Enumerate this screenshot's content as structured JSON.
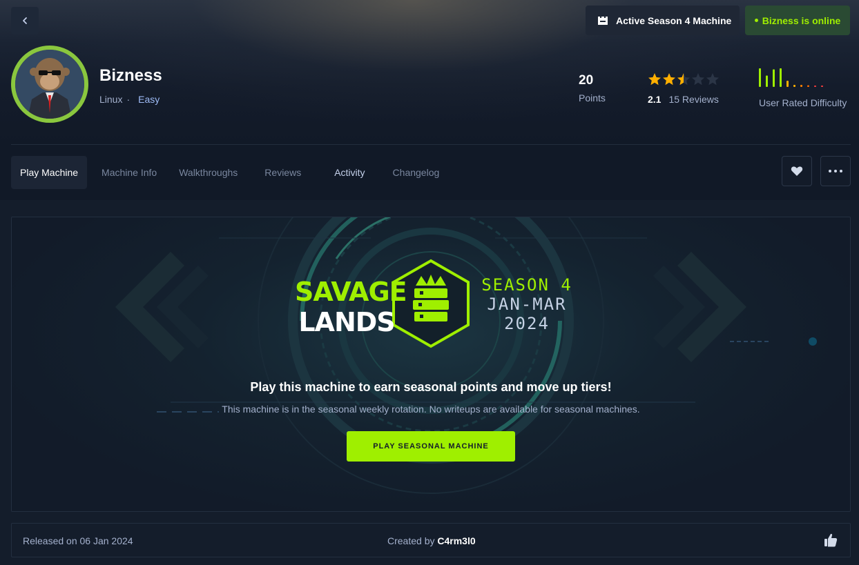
{
  "header": {
    "back_icon": "chevron-left-icon",
    "season_badge": {
      "icon": "castle-icon",
      "label": "Active Season 4 Machine"
    },
    "status_badge": {
      "label": "Bizness is online",
      "color": "#9fef00"
    }
  },
  "machine": {
    "name": "Bizness",
    "os": "Linux",
    "separator": "·",
    "difficulty": "Easy",
    "avatar_icon": "monkey-avatar-icon",
    "points": {
      "value": "20",
      "label": "Points"
    },
    "rating": {
      "value": "2.1",
      "reviews": "15 Reviews",
      "stars": 2.5,
      "max_stars": 5,
      "star_color": "#ffaf00"
    },
    "user_difficulty": {
      "label": "User Rated Difficulty",
      "levels": [
        0.9,
        0.55,
        0.85,
        0.9,
        0.3,
        0.1,
        0.1,
        0.08,
        0.06,
        0.06
      ],
      "colors": [
        "#9fef00",
        "#9fef00",
        "#9fef00",
        "#9fef00",
        "#ffaf00",
        "#ffaf00",
        "#ff8000",
        "#ff6b00",
        "#ff3e3e",
        "#ff3e3e"
      ]
    }
  },
  "tabs": [
    {
      "label": "Play Machine",
      "active": true
    },
    {
      "label": "Machine Info"
    },
    {
      "label": "Walkthroughs"
    },
    {
      "label": "Reviews"
    },
    {
      "label": "Activity"
    },
    {
      "label": "Changelog"
    }
  ],
  "actions": {
    "favorite_icon": "heart-icon",
    "more_icon": "more-horizontal-icon"
  },
  "banner": {
    "logo_line1": "SAVAGE",
    "logo_line2": "LANDS",
    "season_line1": "SEASON 4",
    "season_line2": "JAN-MAR",
    "season_line3": "2024",
    "emblem_icon": "crowned-server-hexagon-icon",
    "title": "Play this machine to earn seasonal points and move up tiers!",
    "subtitle": "This machine is in the seasonal weekly rotation. No writeups are available for seasonal machines.",
    "button_label": "PLAY SEASONAL MACHINE"
  },
  "footer": {
    "released": "Released on 06 Jan 2024",
    "created_prefix": "Created by",
    "creator": "C4rm3l0",
    "like_icon": "thumbs-up-icon"
  },
  "colors": {
    "accent": "#9fef00",
    "background": "#111927",
    "panel": "#141d2b"
  }
}
